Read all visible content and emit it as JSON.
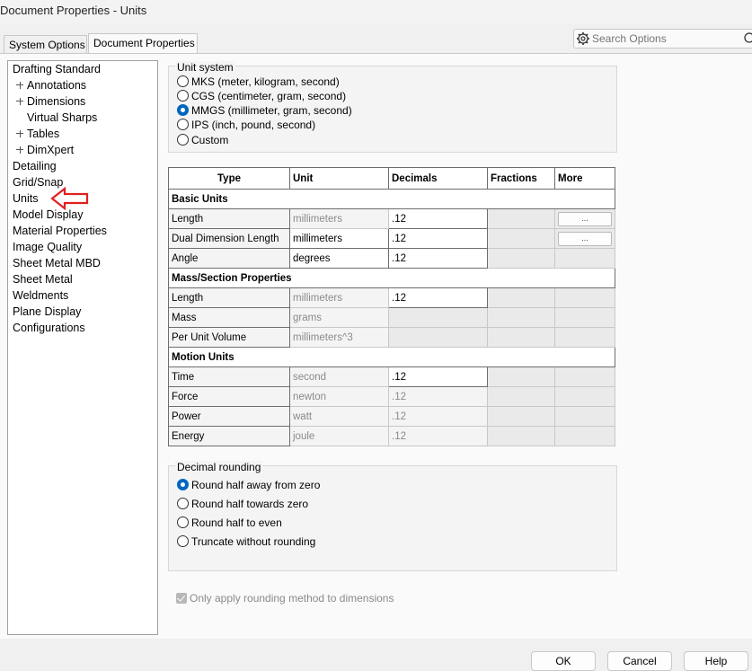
{
  "window": {
    "title": "Document Properties - Units"
  },
  "tabs": {
    "system_options": "System Options",
    "document_properties": "Document Properties"
  },
  "search": {
    "placeholder": "Search Options"
  },
  "tree": {
    "items": [
      {
        "label": "Drafting Standard"
      },
      {
        "label": "Annotations"
      },
      {
        "label": "Dimensions"
      },
      {
        "label": "Virtual Sharps"
      },
      {
        "label": "Tables"
      },
      {
        "label": "DimXpert"
      },
      {
        "label": "Detailing"
      },
      {
        "label": "Grid/Snap"
      },
      {
        "label": "Units"
      },
      {
        "label": "Model Display"
      },
      {
        "label": "Material Properties"
      },
      {
        "label": "Image Quality"
      },
      {
        "label": "Sheet Metal MBD"
      },
      {
        "label": "Sheet Metal"
      },
      {
        "label": "Weldments"
      },
      {
        "label": "Plane Display"
      },
      {
        "label": "Configurations"
      }
    ]
  },
  "unit_system": {
    "title": "Unit system",
    "options": [
      {
        "label": "MKS  (meter, kilogram, second)",
        "selected": false
      },
      {
        "label": "CGS  (centimeter, gram, second)",
        "selected": false
      },
      {
        "label": "MMGS (millimeter, gram, second)",
        "selected": true
      },
      {
        "label": "IPS  (inch, pound, second)",
        "selected": false
      },
      {
        "label": "Custom",
        "selected": false
      }
    ]
  },
  "table": {
    "headers": {
      "type": "Type",
      "unit": "Unit",
      "decimals": "Decimals",
      "fractions": "Fractions",
      "more": "More"
    },
    "sections": {
      "basic": "Basic Units",
      "mass": "Mass/Section Properties",
      "motion": "Motion Units"
    },
    "rows": [
      {
        "type": "Length",
        "unit": "millimeters",
        "decimals": ".12",
        "more": "..."
      },
      {
        "type": "Dual Dimension Length",
        "unit": "millimeters",
        "decimals": ".12",
        "more": "..."
      },
      {
        "type": "Angle",
        "unit": "degrees",
        "decimals": ".12"
      },
      {
        "type": "Length",
        "unit": "millimeters",
        "decimals": ".12"
      },
      {
        "type": "Mass",
        "unit": "grams"
      },
      {
        "type": "Per Unit Volume",
        "unit": "millimeters^3"
      },
      {
        "type": "Time",
        "unit": "second",
        "decimals": ".12"
      },
      {
        "type": "Force",
        "unit": "newton",
        "decimals": ".12"
      },
      {
        "type": "Power",
        "unit": "watt",
        "decimals": ".12"
      },
      {
        "type": "Energy",
        "unit": "joule",
        "decimals": ".12"
      }
    ]
  },
  "decimal_rounding": {
    "title": "Decimal rounding",
    "options": [
      {
        "label": "Round half away from zero",
        "selected": true
      },
      {
        "label": "Round half towards zero",
        "selected": false
      },
      {
        "label": "Round half to even",
        "selected": false
      },
      {
        "label": "Truncate without rounding",
        "selected": false
      }
    ]
  },
  "only_apply": {
    "label": "Only apply rounding method to dimensions",
    "checked": true
  },
  "buttons": {
    "ok": "OK",
    "cancel": "Cancel",
    "help": "Help"
  },
  "colors": {
    "accent": "#0067c0",
    "arrow": "#e02020"
  }
}
